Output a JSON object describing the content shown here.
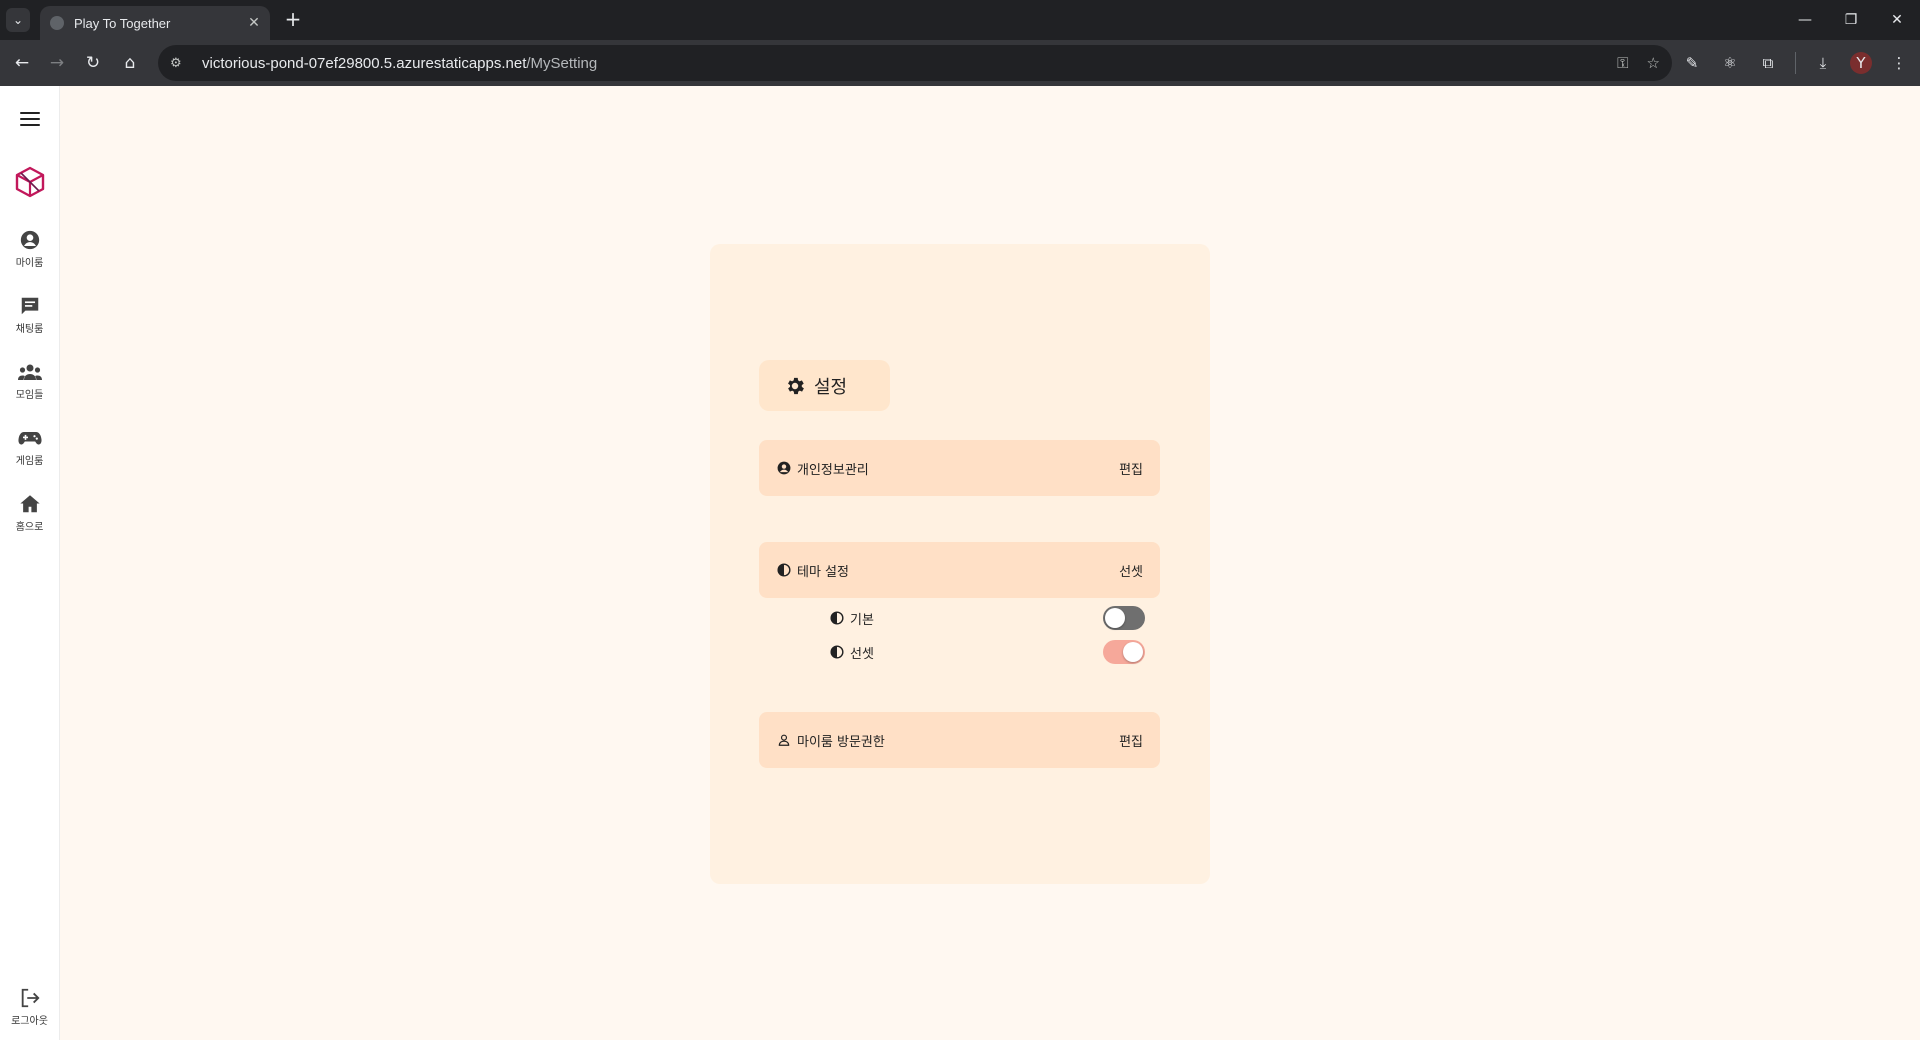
{
  "browser": {
    "tab_title": "Play To Together",
    "url_host": "victorious-pond-07ef29800.5.azurestaticapps.net",
    "url_path": "/MySetting",
    "avatar_letter": "Y"
  },
  "sidebar": {
    "items": [
      {
        "label": "마이룸",
        "icon": "user-circle-icon"
      },
      {
        "label": "채팅룸",
        "icon": "chat-icon"
      },
      {
        "label": "모임들",
        "icon": "group-icon"
      },
      {
        "label": "게임룸",
        "icon": "gamepad-icon"
      },
      {
        "label": "홈으로",
        "icon": "home-icon"
      }
    ],
    "logout_label": "로그아웃"
  },
  "settings": {
    "title": "설정",
    "privacy": {
      "label": "개인정보관리",
      "action": "편집"
    },
    "theme": {
      "label": "테마 설정",
      "current": "선셋",
      "options": [
        {
          "label": "기본",
          "enabled": false
        },
        {
          "label": "선셋",
          "enabled": true
        }
      ]
    },
    "visit": {
      "label": "마이룸 방문권한",
      "action": "편집"
    }
  },
  "colors": {
    "page_bg": "#fff8f1",
    "card_bg": "#fff1e1",
    "row_bg": "#ffe0c6",
    "toggle_on": "#f6a89a",
    "toggle_off": "#6f6f6f",
    "logo_accent": "#c2185b"
  }
}
